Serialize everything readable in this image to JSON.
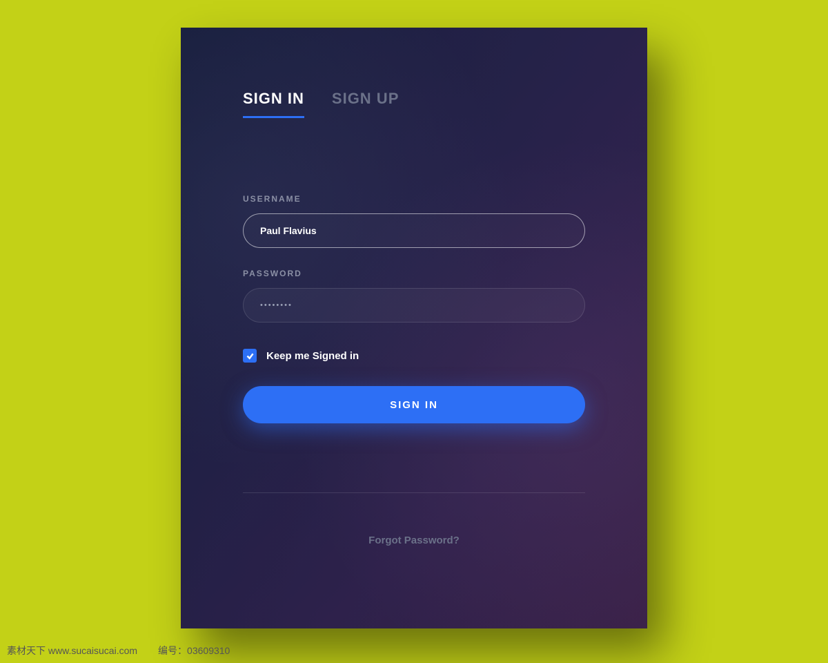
{
  "tabs": {
    "sign_in": "SIGN IN",
    "sign_up": "SIGN UP"
  },
  "form": {
    "username_label": "USERNAME",
    "username_value": "Paul Flavius",
    "password_label": "PASSWORD",
    "password_value": "••••••••",
    "remember_label": "Keep me Signed in",
    "remember_checked": true,
    "submit_label": "SIGN IN",
    "forgot_label": "Forgot Password?"
  },
  "meta": {
    "site_label": "素材天下 www.sucaisucai.com",
    "id_label": "编号：03609310"
  },
  "colors": {
    "background": "#c3d117",
    "accent": "#2d6ff5"
  }
}
